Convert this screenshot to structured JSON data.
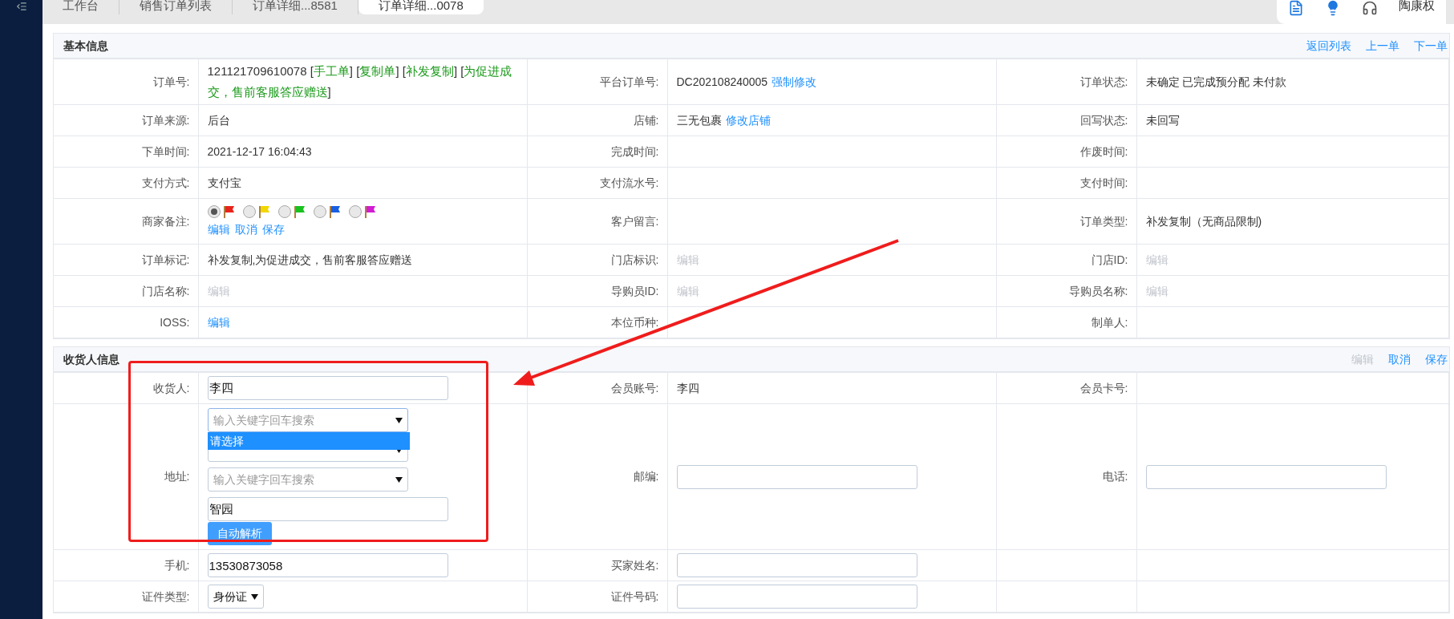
{
  "tabs": [
    {
      "label": "工作台",
      "selected": false
    },
    {
      "label": "销售订单列表",
      "selected": false
    },
    {
      "label": "订单详细...8581",
      "selected": false
    },
    {
      "label": "订单详细...0078",
      "selected": true
    }
  ],
  "user": {
    "name": "陶康权"
  },
  "sections": [
    {
      "title": "基本信息",
      "actions": [
        {
          "text": "返回列表",
          "disabled": false
        },
        {
          "text": "上一单",
          "disabled": false
        },
        {
          "text": "下一单",
          "disabled": false
        }
      ],
      "rows": [
        {
          "kind": "tall",
          "cells": [
            {
              "label": "订单号:",
              "kind": "order",
              "parts": [
                {
                  "text": "121121709610078 [",
                  "tag": false
                },
                {
                  "text": "手工单",
                  "tag": true
                },
                {
                  "text": "] [",
                  "tag": false
                },
                {
                  "text": "复制单",
                  "tag": true
                },
                {
                  "text": "] [",
                  "tag": false
                },
                {
                  "text": "补发复制",
                  "tag": true
                },
                {
                  "text": "] [",
                  "tag": false
                },
                {
                  "text": "为促进成交，售前客服答应赠送",
                  "tag": true
                },
                {
                  "text": "]",
                  "tag": false
                }
              ]
            },
            {
              "label": "平台订单号:",
              "kind": "text_link",
              "text": "DC202108240005",
              "link": "强制修改"
            },
            {
              "label": "订单状态:",
              "kind": "text",
              "text": "未确定 已完成预分配 未付款"
            }
          ]
        },
        {
          "kind": "normal",
          "cells": [
            {
              "label": "订单来源:",
              "kind": "text",
              "text": "后台"
            },
            {
              "label": "店铺:",
              "kind": "text_link",
              "text": "三无包裹",
              "link": "修改店铺"
            },
            {
              "label": "回写状态:",
              "kind": "text",
              "text": "未回写"
            }
          ]
        },
        {
          "kind": "normal",
          "cells": [
            {
              "label": "下单时间:",
              "kind": "text",
              "text": "2021-12-17 16:04:43"
            },
            {
              "label": "完成时间:",
              "kind": "empty"
            },
            {
              "label": "作废时间:",
              "kind": "empty"
            }
          ]
        },
        {
          "kind": "normal",
          "cells": [
            {
              "label": "支付方式:",
              "kind": "text",
              "text": "支付宝"
            },
            {
              "label": "支付流水号:",
              "kind": "empty"
            },
            {
              "label": "支付时间:",
              "kind": "empty"
            }
          ]
        },
        {
          "kind": "tall",
          "cells": [
            {
              "label": "商家备注:",
              "kind": "flags",
              "flags": [
                {
                  "color": "#e8231b",
                  "selected": true
                },
                {
                  "color": "#f2d600",
                  "selected": false
                },
                {
                  "color": "#19c21f",
                  "selected": false
                },
                {
                  "color": "#1a5fe0",
                  "selected": false
                },
                {
                  "color": "#d21bd2",
                  "selected": false
                }
              ],
              "links": [
                "编辑",
                "取消",
                "保存"
              ]
            },
            {
              "label": "客户留言:",
              "kind": "empty"
            },
            {
              "label": "订单类型:",
              "kind": "text",
              "text": "补发复制（无商品限制)"
            }
          ]
        },
        {
          "kind": "normal",
          "cells": [
            {
              "label": "订单标记:",
              "kind": "text",
              "text": "补发复制,为促进成交，售前客服答应赠送"
            },
            {
              "label": "门店标识:",
              "kind": "link",
              "text": "编辑",
              "disabled": true
            },
            {
              "label": "门店ID:",
              "kind": "link",
              "text": "编辑",
              "disabled": true
            }
          ]
        },
        {
          "kind": "normal",
          "cells": [
            {
              "label": "门店名称:",
              "kind": "link",
              "text": "编辑",
              "disabled": true
            },
            {
              "label": "导购员ID:",
              "kind": "link",
              "text": "编辑",
              "disabled": true
            },
            {
              "label": "导购员名称:",
              "kind": "link",
              "text": "编辑",
              "disabled": true
            }
          ]
        },
        {
          "kind": "normal",
          "cells": [
            {
              "label": "IOSS:",
              "kind": "link",
              "text": "编辑",
              "disabled": false
            },
            {
              "label": "本位币种:",
              "kind": "empty"
            },
            {
              "label": "制单人:",
              "kind": "empty"
            }
          ]
        }
      ]
    },
    {
      "title": "收货人信息",
      "actions": [
        {
          "text": "编辑",
          "disabled": true
        },
        {
          "text": "取消",
          "disabled": false
        },
        {
          "text": "保存",
          "disabled": false
        }
      ],
      "rows": [
        {
          "kind": "normal",
          "cells": [
            {
              "label": "收货人:",
              "kind": "input",
              "value": "李四"
            },
            {
              "label": "会员账号:",
              "kind": "text",
              "text": "李四"
            },
            {
              "label": "会员卡号:",
              "kind": "empty"
            }
          ]
        },
        {
          "kind": "address",
          "cells": [
            {
              "label": "地址:",
              "kind": "address",
              "selects": [
                {
                  "placeholder": "输入关键字回车搜索",
                  "open": true,
                  "options": [
                    {
                      "text": "请选择",
                      "selected": true
                    }
                  ]
                },
                {
                  "open": false
                },
                {
                  "placeholder": "输入关键字回车搜索",
                  "open": false
                }
              ],
              "detail": "智园",
              "button": "自动解析"
            },
            {
              "label": "邮编:",
              "kind": "input"
            },
            {
              "label": "电话:",
              "kind": "input"
            }
          ]
        },
        {
          "kind": "normal",
          "cells": [
            {
              "label": "手机:",
              "kind": "input",
              "value": "13530873058"
            },
            {
              "label": "买家姓名:",
              "kind": "input"
            },
            {
              "kind": "empty"
            }
          ]
        },
        {
          "kind": "normal",
          "cells": [
            {
              "label": "证件类型:",
              "kind": "select",
              "value": "身份证"
            },
            {
              "label": "证件号码:",
              "kind": "input"
            },
            {
              "kind": "empty"
            }
          ]
        }
      ]
    }
  ]
}
